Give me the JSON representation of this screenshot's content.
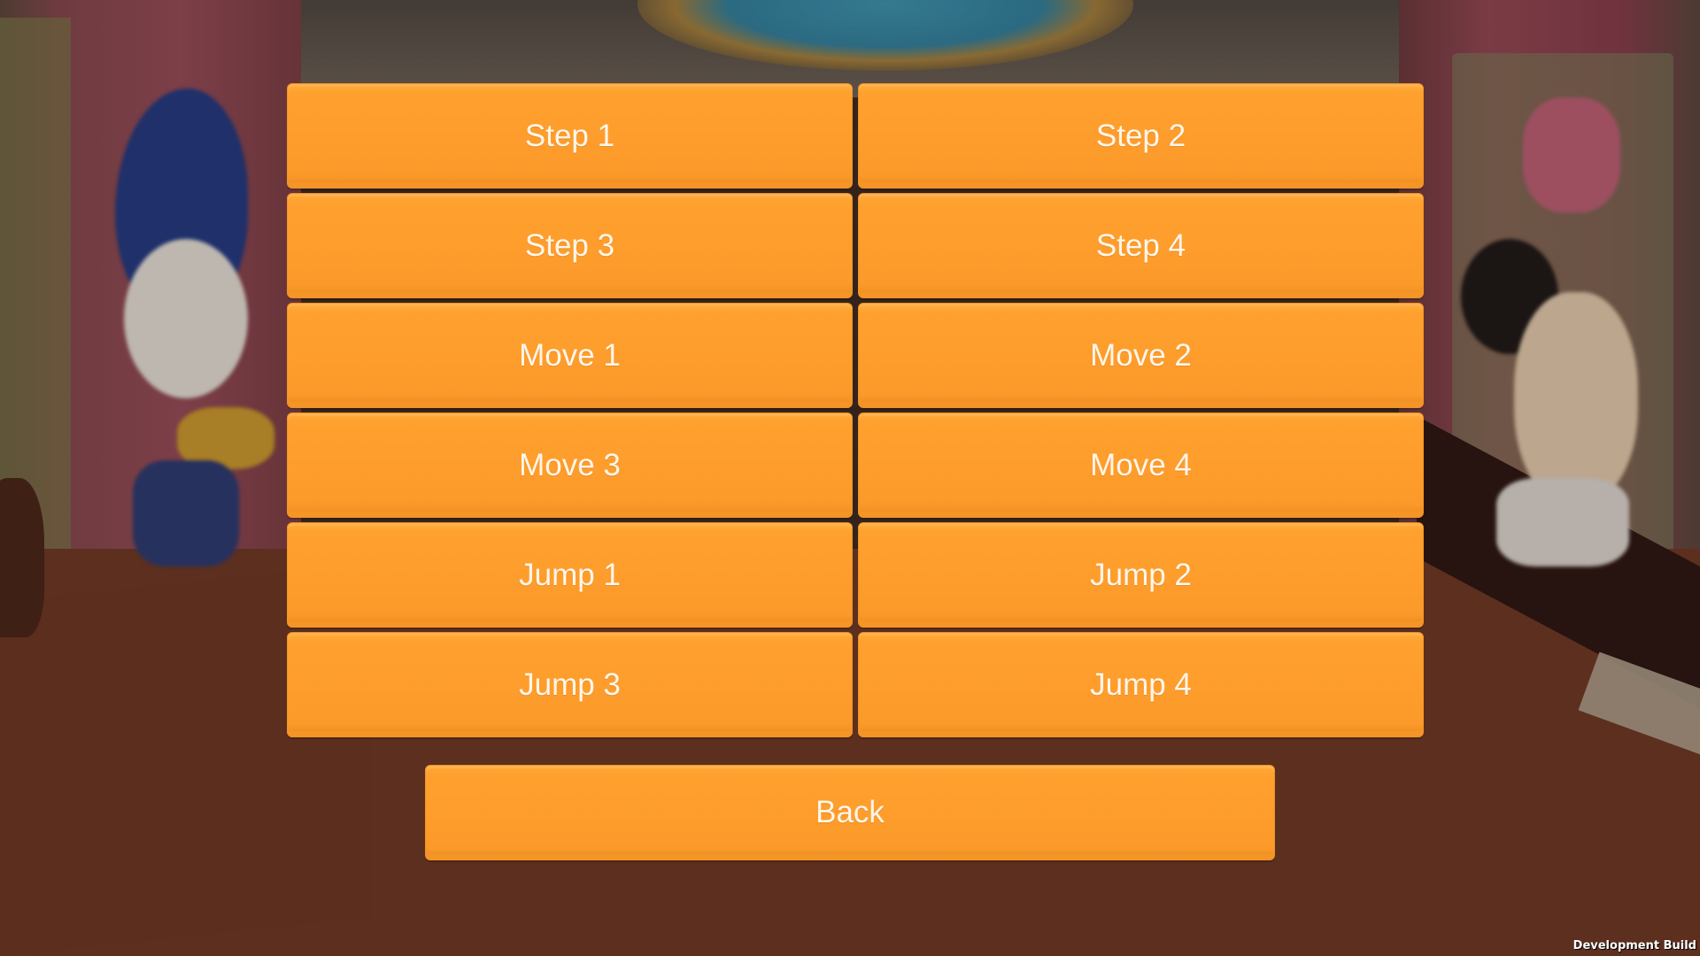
{
  "menu": {
    "buttons": [
      {
        "label": "Step 1"
      },
      {
        "label": "Step 2"
      },
      {
        "label": "Step 3"
      },
      {
        "label": "Step 4"
      },
      {
        "label": "Move 1"
      },
      {
        "label": "Move 2"
      },
      {
        "label": "Move 3"
      },
      {
        "label": "Move 4"
      },
      {
        "label": "Jump 1"
      },
      {
        "label": "Jump 2"
      },
      {
        "label": "Jump 3"
      },
      {
        "label": "Jump 4"
      }
    ],
    "back_label": "Back"
  },
  "footer": {
    "build_label": "Development Build"
  },
  "colors": {
    "button_orange": "#fe9d2c",
    "button_text": "#fff6ea",
    "floor": "#713a26"
  }
}
